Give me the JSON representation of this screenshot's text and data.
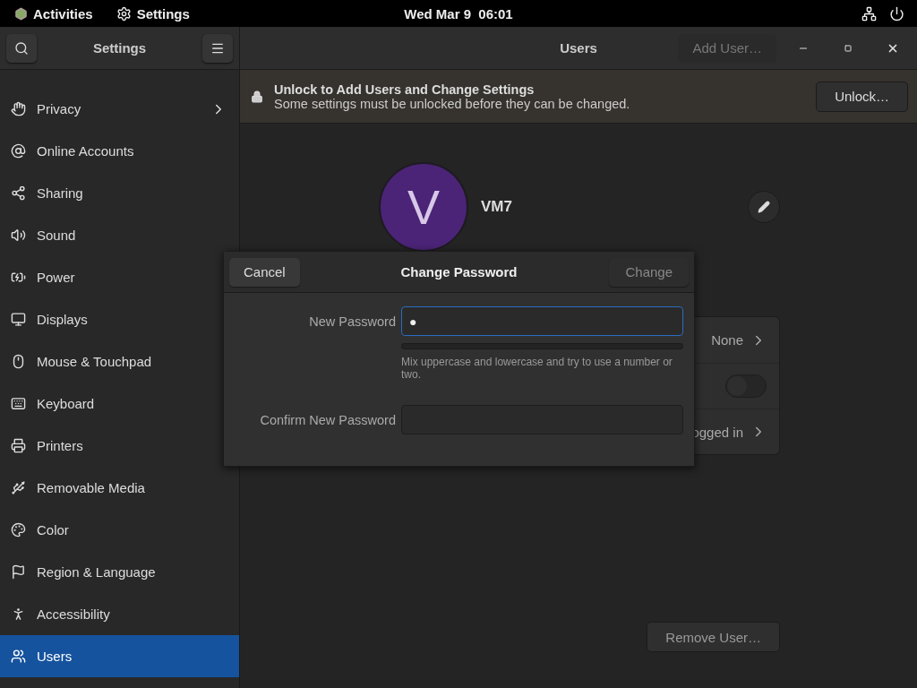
{
  "top_bar": {
    "activities": "Activities",
    "app_menu": "Settings",
    "clock": "Wed Mar 9  06:01"
  },
  "sidebar": {
    "title": "Settings",
    "items": [
      {
        "label": "Privacy",
        "selected": false,
        "has_submenu": true
      },
      {
        "label": "Online Accounts",
        "selected": false,
        "has_submenu": false
      },
      {
        "label": "Sharing",
        "selected": false,
        "has_submenu": false
      },
      {
        "label": "Sound",
        "selected": false,
        "has_submenu": false
      },
      {
        "label": "Power",
        "selected": false,
        "has_submenu": false
      },
      {
        "label": "Displays",
        "selected": false,
        "has_submenu": false
      },
      {
        "label": "Mouse & Touchpad",
        "selected": false,
        "has_submenu": false
      },
      {
        "label": "Keyboard",
        "selected": false,
        "has_submenu": false
      },
      {
        "label": "Printers",
        "selected": false,
        "has_submenu": false
      },
      {
        "label": "Removable Media",
        "selected": false,
        "has_submenu": false
      },
      {
        "label": "Color",
        "selected": false,
        "has_submenu": false
      },
      {
        "label": "Region & Language",
        "selected": false,
        "has_submenu": false
      },
      {
        "label": "Accessibility",
        "selected": false,
        "has_submenu": false
      },
      {
        "label": "Users",
        "selected": true,
        "has_submenu": false
      }
    ]
  },
  "header": {
    "title": "Users",
    "add_user": {
      "label": "Add User…",
      "disabled": true
    }
  },
  "banner": {
    "title": "Unlock to Add Users and Change Settings",
    "subtitle": "Some settings must be unlocked before they can be changed.",
    "button": "Unlock…"
  },
  "user": {
    "initial": "V",
    "name": "VM7"
  },
  "settings_rows": [
    {
      "kind": "link",
      "value": "None"
    },
    {
      "kind": "switch",
      "on": false
    },
    {
      "kind": "link",
      "value": "ogged in"
    }
  ],
  "remove_user": "Remove User…",
  "dialog": {
    "title": "Change Password",
    "cancel": "Cancel",
    "confirm": {
      "label": "Change",
      "disabled": true
    },
    "new_password": {
      "label": "New Password",
      "value": "●",
      "focused": true
    },
    "strength": {
      "level": 0
    },
    "hint": "Mix uppercase and lowercase and try to use a number or two.",
    "confirm_password": {
      "label": "Confirm New Password",
      "focused": false
    }
  }
}
